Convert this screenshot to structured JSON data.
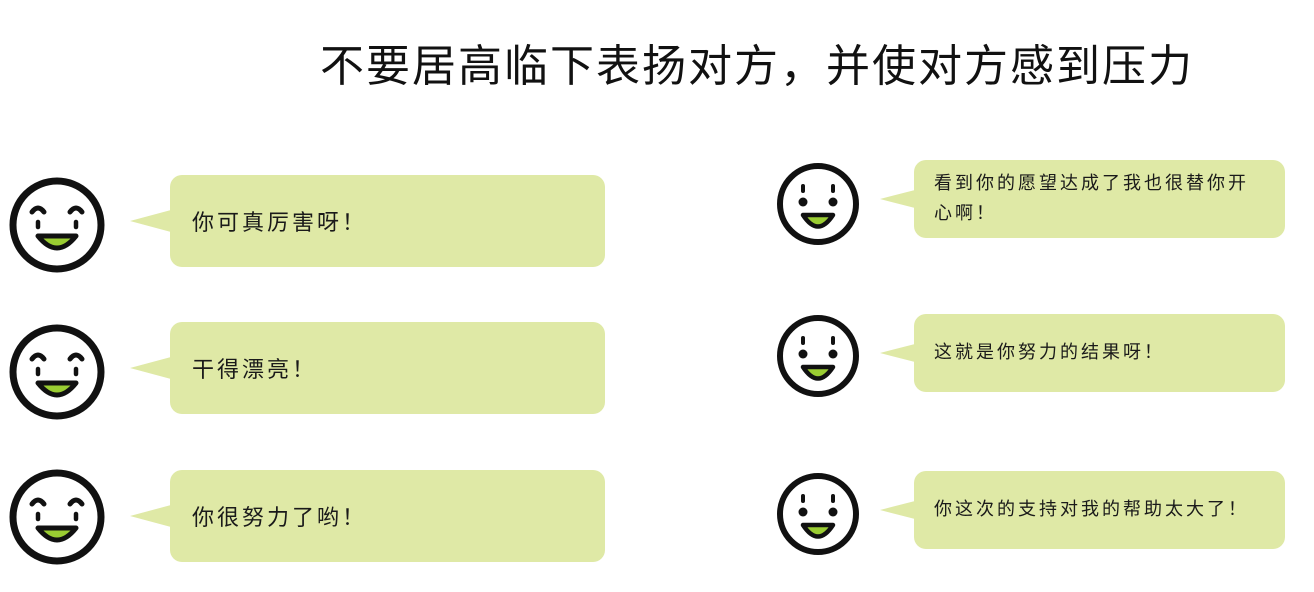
{
  "title": "不要居高临下表扬对方，并使对方感到压力",
  "colors": {
    "bubble": "#dfe9a6",
    "mouth": "#9acd32",
    "outline": "#111111"
  },
  "left_column": {
    "items": [
      {
        "icon": "laughing-face-icon",
        "text": "你可真厉害呀！"
      },
      {
        "icon": "laughing-face-icon",
        "text": "干得漂亮！"
      },
      {
        "icon": "laughing-face-icon",
        "text": "你很努力了哟！"
      }
    ]
  },
  "right_column": {
    "items": [
      {
        "icon": "smiling-face-icon",
        "text": "看到你的愿望达成了我也很替你开心啊！"
      },
      {
        "icon": "smiling-face-icon",
        "text": "这就是你努力的结果呀！"
      },
      {
        "icon": "smiling-face-icon",
        "text": "你这次的支持对我的帮助太大了！"
      }
    ]
  }
}
